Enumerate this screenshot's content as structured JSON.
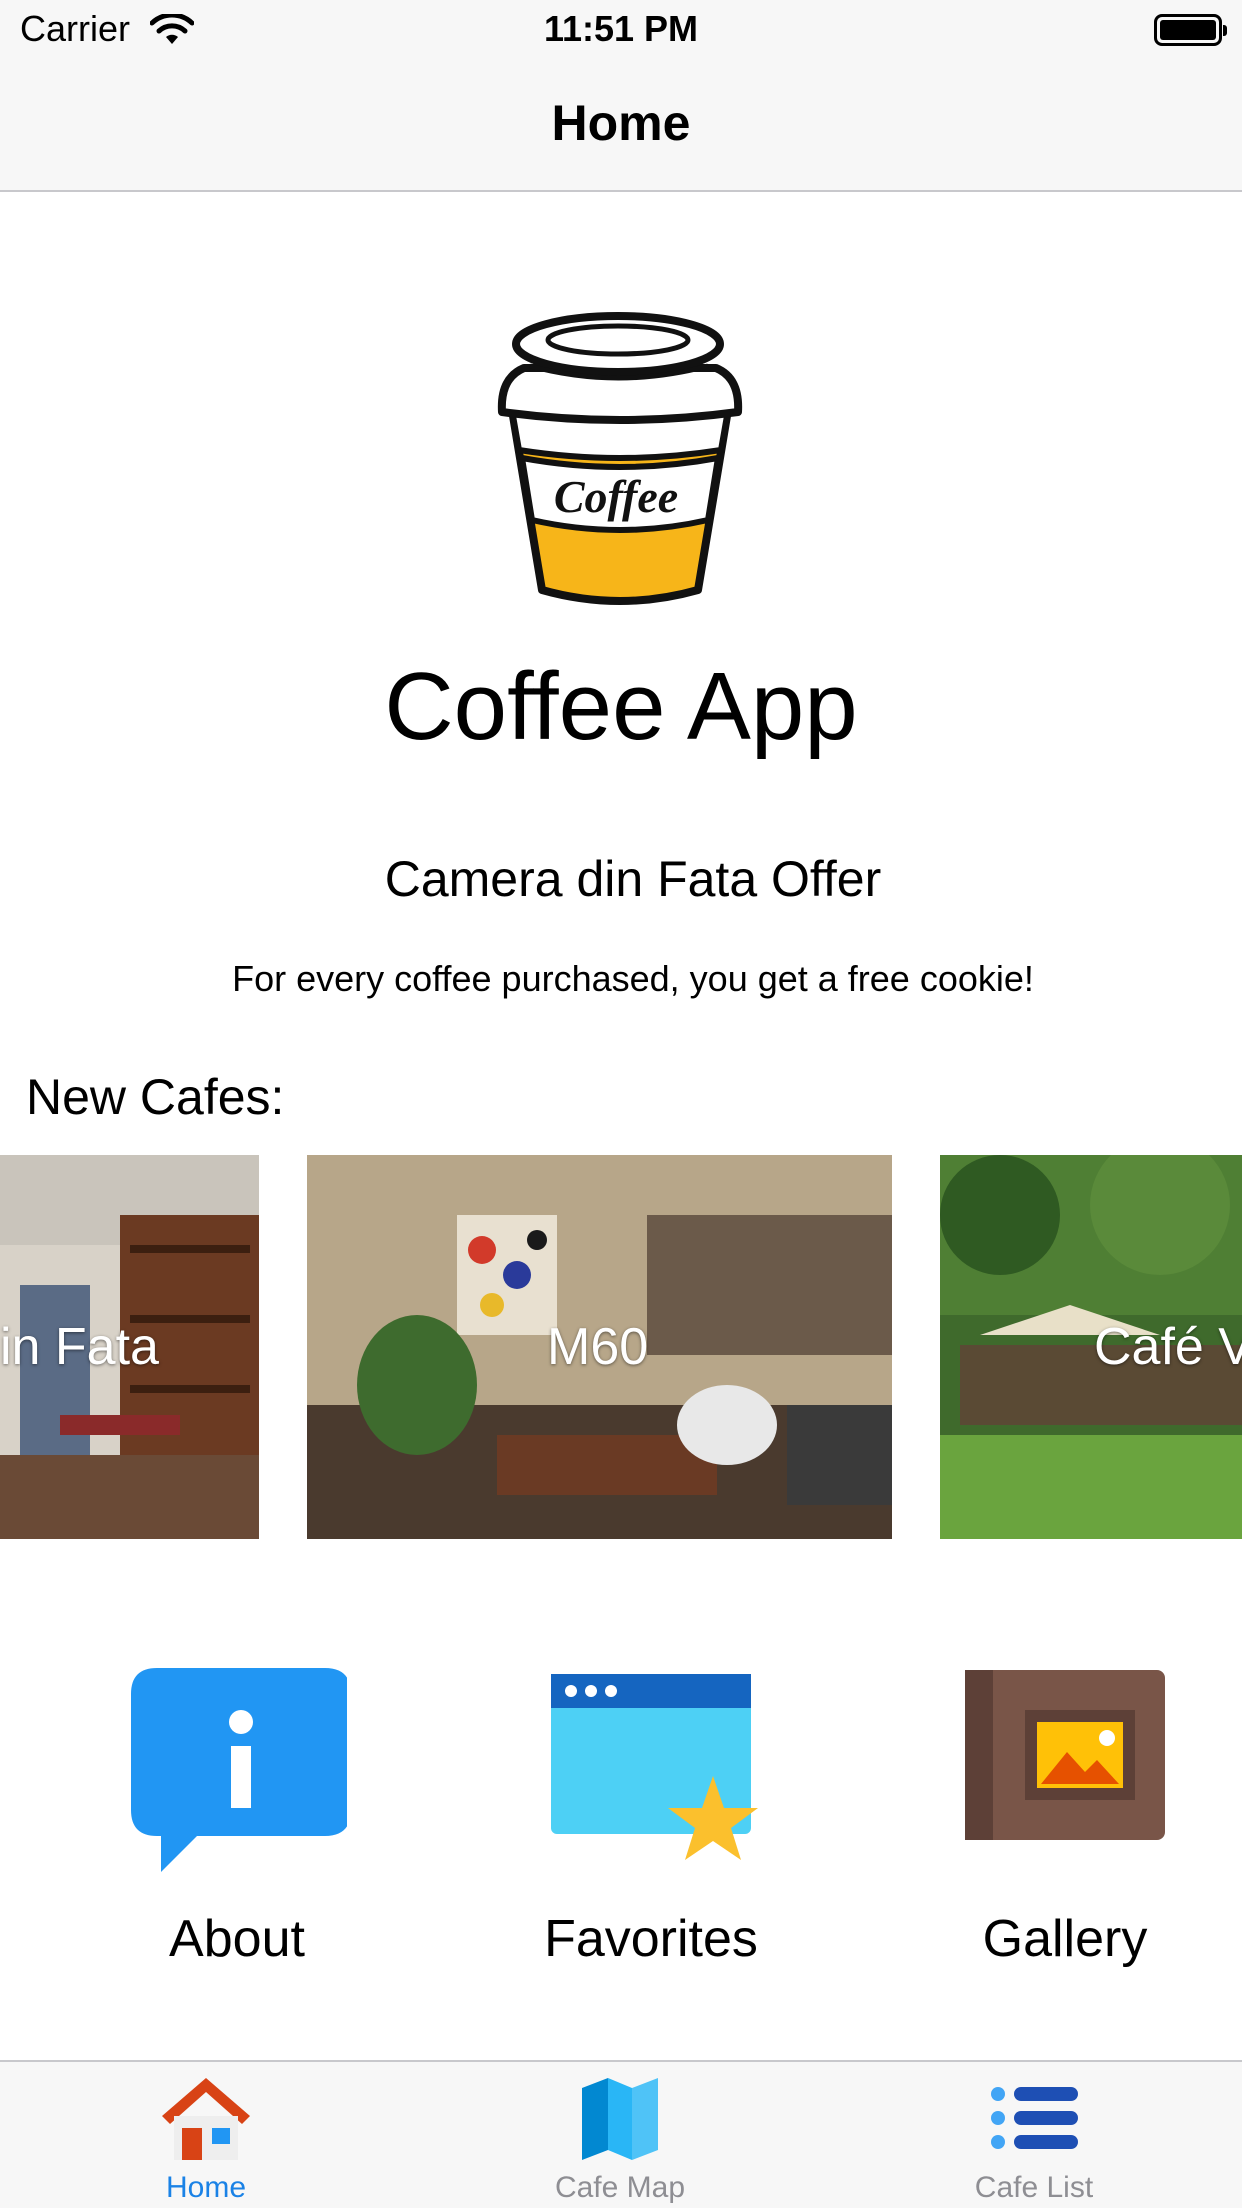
{
  "status": {
    "carrier": "Carrier",
    "time": "11:51 PM"
  },
  "nav": {
    "title": "Home"
  },
  "hero": {
    "logo_text": "Coffee",
    "app_title": "Coffee App"
  },
  "offer": {
    "title": "Camera din Fata Offer",
    "text": "For every coffee purchased, you get a free cookie!"
  },
  "new_cafes": {
    "title": "New Cafes:",
    "cards": [
      {
        "label": "in Fata"
      },
      {
        "label": "M60"
      },
      {
        "label": "Café V"
      }
    ]
  },
  "actions": [
    {
      "label": "About",
      "icon": "info-bubble-icon"
    },
    {
      "label": "Favorites",
      "icon": "window-star-icon"
    },
    {
      "label": "Gallery",
      "icon": "photo-album-icon"
    }
  ],
  "tabs": [
    {
      "label": "Home",
      "icon": "house-icon",
      "selected": true
    },
    {
      "label": "Cafe Map",
      "icon": "map-icon",
      "selected": false
    },
    {
      "label": "Cafe List",
      "icon": "list-icon",
      "selected": false
    }
  ],
  "colors": {
    "accent": "#1a82e6",
    "tab_inactive": "#8e8e93",
    "coffee_yellow": "#f7b519"
  }
}
